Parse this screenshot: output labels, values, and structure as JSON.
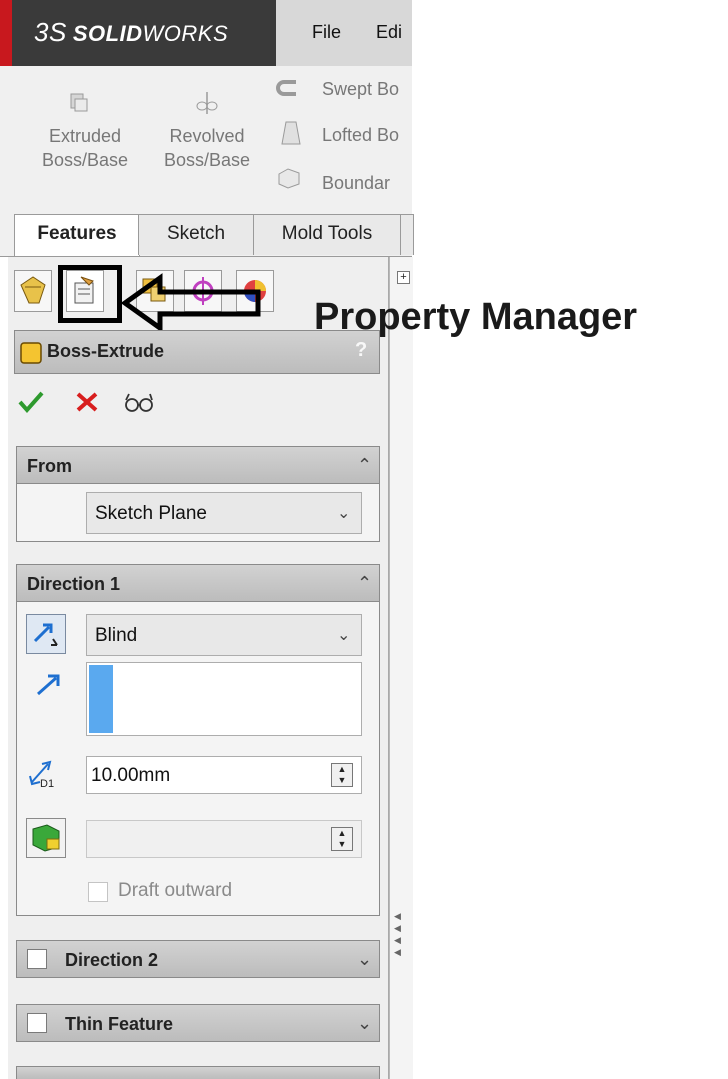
{
  "app": {
    "logo_prefix": "3S",
    "logo_bold": "SOLID",
    "logo_light": "WORKS",
    "menu": [
      "File",
      "Edi"
    ]
  },
  "ribbon": {
    "extruded": [
      "Extruded",
      "Boss/Base"
    ],
    "revolved": [
      "Revolved",
      "Boss/Base"
    ],
    "swept": "Swept Bo",
    "lofted": "Lofted Bo",
    "boundary": "Boundar"
  },
  "tabs": [
    "Features",
    "Sketch",
    "Mold Tools"
  ],
  "tree_expand": "+",
  "annotation": {
    "label": "Property Manager"
  },
  "property_manager": {
    "title": "Boss-Extrude",
    "help": "?",
    "from": {
      "title": "From",
      "value": "Sketch Plane"
    },
    "direction1": {
      "title": "Direction 1",
      "end_condition": "Blind",
      "depth": "10.00mm",
      "depth_icon_label": "D1",
      "draft_label": "Draft outward"
    },
    "direction2": {
      "title": "Direction 2"
    },
    "thin": {
      "title": "Thin Feature"
    }
  },
  "colors": {
    "accent_red": "#c8181e",
    "ok_green": "#2e9a2e",
    "cancel_red": "#d81e1e",
    "direction_blue": "#1e6fd0",
    "selection_blue": "#5aa9ef"
  }
}
